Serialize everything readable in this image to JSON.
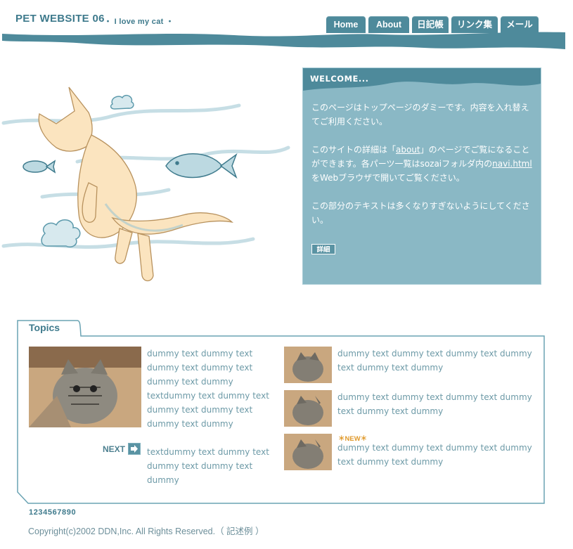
{
  "header": {
    "site_title": "PET WEBSITE 06",
    "tagline": "・ I love my cat ・",
    "nav": [
      "Home",
      "About",
      "日記帳",
      "リンク集",
      "メール"
    ]
  },
  "welcome": {
    "title": "WELCOME...",
    "p1": "このページはトップページのダミーです。内容を入れ替えてご利用ください。",
    "p2_pre": "このサイトの詳細は「",
    "p2_link1": "about",
    "p2_mid": "」のページでご覧になることができます。各パーツ一覧はsozaiフォルダ内の",
    "p2_link2": "navi.html",
    "p2_post": "をWebブラウザで開いてご覧ください。",
    "p3": "この部分のテキストは多くなりすぎないようにしてください。",
    "detail_button": "詳細"
  },
  "topics": {
    "label": "Topics",
    "main_text": "dummy text dummy text dummy text dummy text dummy text dummy textdummy text dummy text dummy text dummy text dummy text dummy",
    "next_label": "NEXT",
    "next_text": "textdummy text dummy text dummy text dummy text dummy",
    "items": [
      {
        "text": "dummy text dummy text dummy text dummy text dummy text dummy"
      },
      {
        "text": "dummy text dummy text dummy text dummy text dummy text dummy"
      },
      {
        "text": "dummy text dummy text dummy text dummy text dummy text dummy"
      }
    ],
    "new_badge": "＊NEW＊"
  },
  "footer": {
    "pager": "1234567890",
    "copyright": "Copyright(c)2002 DDN,Inc. All Rights Reserved.（ 記述例 ）"
  },
  "colors": {
    "accent": "#4e8a9b",
    "welcome_bg": "#8ab8c5",
    "new_badge": "#e09a2c"
  }
}
